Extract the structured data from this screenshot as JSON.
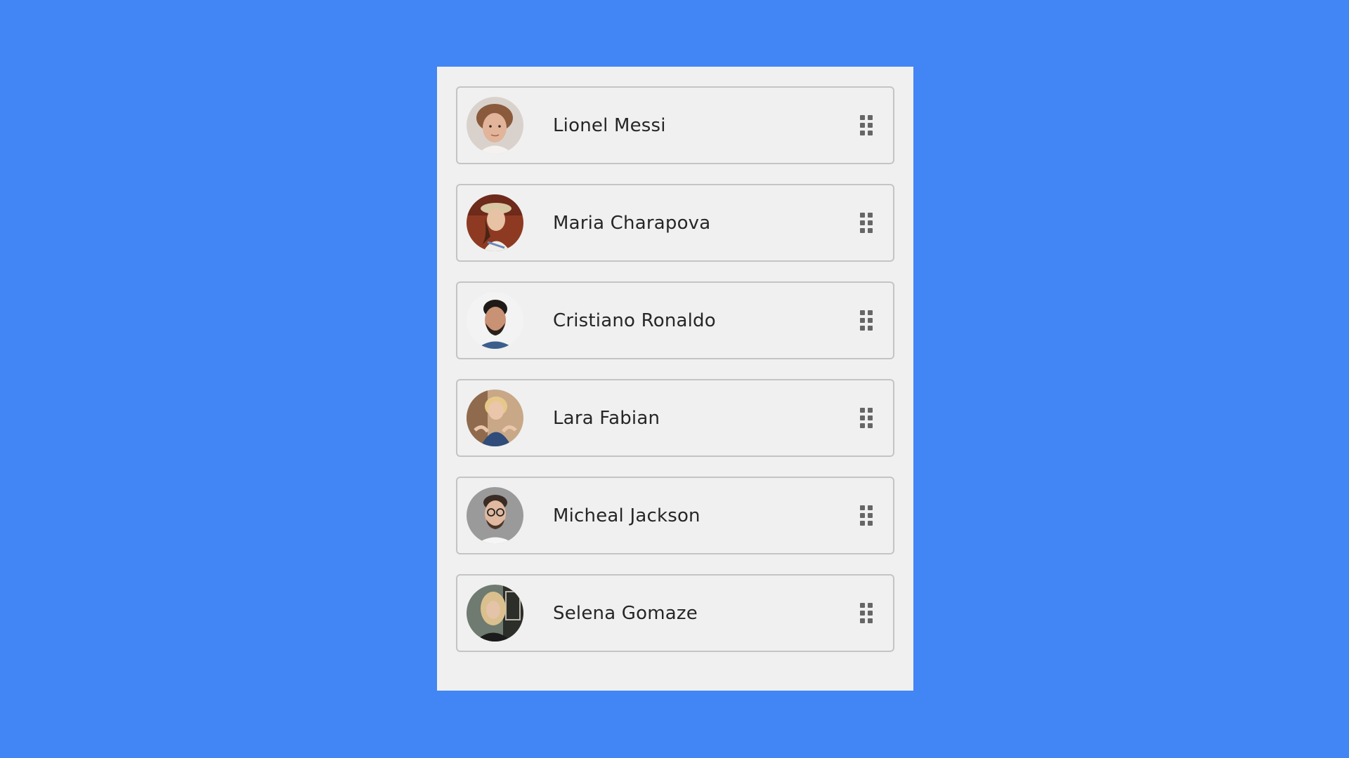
{
  "colors": {
    "page_background": "#4285f4",
    "panel_background": "#f0f0f0",
    "item_border": "#c4c4c4",
    "text": "#262626",
    "handle": "#666666"
  },
  "list": {
    "items": [
      {
        "name": "Lionel Messi",
        "avatar": "photo-young-man-curly-hair",
        "handle_icon": "drag-handle-icon"
      },
      {
        "name": "Maria Charapova",
        "avatar": "photo-woman-dark-hair-red-background",
        "handle_icon": "drag-handle-icon"
      },
      {
        "name": "Cristiano Ronaldo",
        "avatar": "photo-man-beard-blue-shirt",
        "handle_icon": "drag-handle-icon"
      },
      {
        "name": "Lara Fabian",
        "avatar": "photo-blonde-woman-denim",
        "handle_icon": "drag-handle-icon"
      },
      {
        "name": "Micheal Jackson",
        "avatar": "photo-man-glasses-grey-background",
        "handle_icon": "drag-handle-icon"
      },
      {
        "name": "Selena Gomaze",
        "avatar": "photo-blonde-woman-dark-background",
        "handle_icon": "drag-handle-icon"
      }
    ]
  }
}
